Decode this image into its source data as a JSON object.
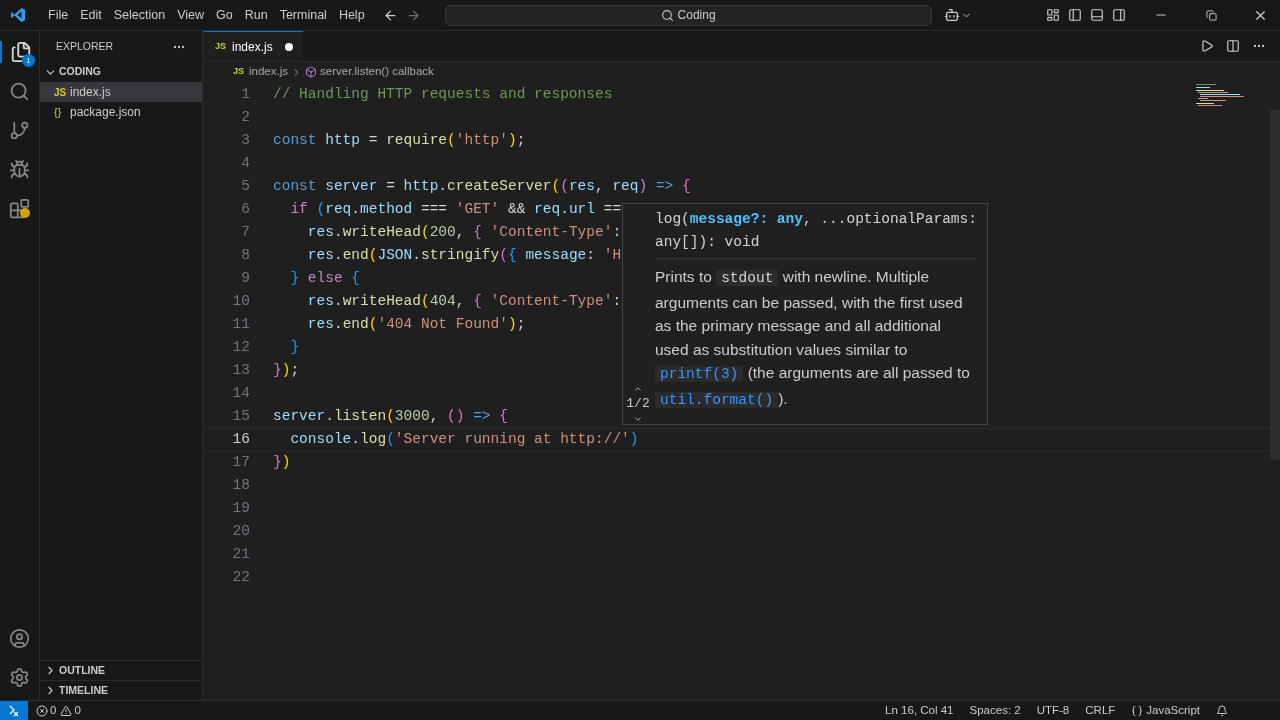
{
  "menu": [
    "File",
    "Edit",
    "Selection",
    "View",
    "Go",
    "Run",
    "Terminal",
    "Help"
  ],
  "command_center": {
    "value": "Coding"
  },
  "activity_bar": {
    "explorer_badge": "1"
  },
  "sidebar": {
    "title": "EXPLORER",
    "folder": "CODING",
    "expanded": true,
    "files": [
      {
        "name": "index.js",
        "icon_text": "JS",
        "kind": "js",
        "selected": true
      },
      {
        "name": "package.json",
        "icon_text": "{}",
        "kind": "json",
        "selected": false
      }
    ],
    "sections": [
      {
        "label": "OUTLINE",
        "expanded": false
      },
      {
        "label": "TIMELINE",
        "expanded": false
      }
    ]
  },
  "tabs": [
    {
      "label": "index.js",
      "icon_text": "JS",
      "modified": true,
      "selected": true
    }
  ],
  "breadcrumb": [
    {
      "label": "index.js",
      "icon_text": "JS",
      "kind": "file"
    },
    {
      "label": "server.listen() callback",
      "kind": "symbol"
    }
  ],
  "lines": [
    {
      "number": "1",
      "current": false,
      "tokens": [
        {
          "text": "// Handling HTTP requests and responses",
          "kind": "comment"
        }
      ]
    },
    {
      "number": "2",
      "current": false
    },
    {
      "number": "3",
      "current": false,
      "tokens": [
        {
          "text": "const",
          "kind": "kw"
        },
        {
          "text": " http",
          "kind": "var"
        },
        {
          "text": " = ",
          "kind": "plain"
        },
        {
          "text": "require",
          "kind": "fn"
        },
        {
          "text": "(",
          "kind": "b1"
        },
        {
          "text": "'http'",
          "kind": "str"
        },
        {
          "text": ")",
          "kind": "b1"
        },
        {
          "text": ";",
          "kind": "plain"
        }
      ]
    },
    {
      "number": "4",
      "current": false
    },
    {
      "number": "5",
      "current": false,
      "tokens": [
        {
          "text": "const",
          "kind": "kw"
        },
        {
          "text": " server",
          "kind": "var"
        },
        {
          "text": " = ",
          "kind": "plain"
        },
        {
          "text": "http",
          "kind": "var"
        },
        {
          "text": ".",
          "kind": "plain"
        },
        {
          "text": "createServer",
          "kind": "fn"
        },
        {
          "text": "(",
          "kind": "b1"
        },
        {
          "text": "(",
          "kind": "b2"
        },
        {
          "text": "res",
          "kind": "var"
        },
        {
          "text": ", ",
          "kind": "plain"
        },
        {
          "text": "req",
          "kind": "var"
        },
        {
          "text": ")",
          "kind": "b2"
        },
        {
          "text": " => ",
          "kind": "kw"
        },
        {
          "text": "{",
          "kind": "b2"
        }
      ]
    },
    {
      "number": "6",
      "current": false,
      "tokens": [
        {
          "text": "  if",
          "kind": "ctrl"
        },
        {
          "text": " (",
          "kind": "b3"
        },
        {
          "text": "req",
          "kind": "var"
        },
        {
          "text": ".",
          "kind": "plain"
        },
        {
          "text": "method",
          "kind": "var"
        },
        {
          "text": " === ",
          "kind": "plain"
        },
        {
          "text": "'GET'",
          "kind": "str"
        },
        {
          "text": " && ",
          "kind": "plain"
        },
        {
          "text": "req",
          "kind": "var"
        },
        {
          "text": ".",
          "kind": "plain"
        },
        {
          "text": "url",
          "kind": "var"
        },
        {
          "text": " ==",
          "kind": "plain"
        }
      ]
    },
    {
      "number": "7",
      "current": false,
      "tokens": [
        {
          "text": "    res",
          "kind": "var"
        },
        {
          "text": ".",
          "kind": "plain"
        },
        {
          "text": "writeHead",
          "kind": "fn"
        },
        {
          "text": "(",
          "kind": "b1"
        },
        {
          "text": "200",
          "kind": "num"
        },
        {
          "text": ", ",
          "kind": "plain"
        },
        {
          "text": "{",
          "kind": "b2"
        },
        {
          "text": " 'Content-Type'",
          "kind": "str"
        },
        {
          "text": ":",
          "kind": "plain"
        }
      ]
    },
    {
      "number": "8",
      "current": false,
      "tokens": [
        {
          "text": "    res",
          "kind": "var"
        },
        {
          "text": ".",
          "kind": "plain"
        },
        {
          "text": "end",
          "kind": "fn"
        },
        {
          "text": "(",
          "kind": "b1"
        },
        {
          "text": "JSON",
          "kind": "var"
        },
        {
          "text": ".",
          "kind": "plain"
        },
        {
          "text": "stringify",
          "kind": "fn"
        },
        {
          "text": "(",
          "kind": "b2"
        },
        {
          "text": "{",
          "kind": "b3"
        },
        {
          "text": " message",
          "kind": "var"
        },
        {
          "text": ": ",
          "kind": "plain"
        },
        {
          "text": "'H",
          "kind": "str"
        }
      ]
    },
    {
      "number": "9",
      "current": false,
      "tokens": [
        {
          "text": "  }",
          "kind": "b3"
        },
        {
          "text": " else",
          "kind": "ctrl"
        },
        {
          "text": " {",
          "kind": "b3"
        }
      ]
    },
    {
      "number": "10",
      "current": false,
      "tokens": [
        {
          "text": "    res",
          "kind": "var"
        },
        {
          "text": ".",
          "kind": "plain"
        },
        {
          "text": "writeHead",
          "kind": "fn"
        },
        {
          "text": "(",
          "kind": "b1"
        },
        {
          "text": "404",
          "kind": "num"
        },
        {
          "text": ", ",
          "kind": "plain"
        },
        {
          "text": "{",
          "kind": "b2"
        },
        {
          "text": " 'Content-Type'",
          "kind": "str"
        },
        {
          "text": ":",
          "kind": "plain"
        }
      ]
    },
    {
      "number": "11",
      "current": false,
      "tokens": [
        {
          "text": "    res",
          "kind": "var"
        },
        {
          "text": ".",
          "kind": "plain"
        },
        {
          "text": "end",
          "kind": "fn"
        },
        {
          "text": "(",
          "kind": "b1"
        },
        {
          "text": "'404 Not Found'",
          "kind": "str"
        },
        {
          "text": ")",
          "kind": "b1"
        },
        {
          "text": ";",
          "kind": "plain"
        }
      ]
    },
    {
      "number": "12",
      "current": false,
      "tokens": [
        {
          "text": "  }",
          "kind": "b3"
        }
      ]
    },
    {
      "number": "13",
      "current": false,
      "tokens": [
        {
          "text": "}",
          "kind": "b2"
        },
        {
          "text": ")",
          "kind": "b1"
        },
        {
          "text": ";",
          "kind": "plain"
        }
      ]
    },
    {
      "number": "14",
      "current": false
    },
    {
      "number": "15",
      "current": false,
      "tokens": [
        {
          "text": "server",
          "kind": "var"
        },
        {
          "text": ".",
          "kind": "plain"
        },
        {
          "text": "listen",
          "kind": "fn"
        },
        {
          "text": "(",
          "kind": "b1"
        },
        {
          "text": "3000",
          "kind": "num"
        },
        {
          "text": ", ",
          "kind": "plain"
        },
        {
          "text": "(",
          "kind": "b2"
        },
        {
          "text": ")",
          "kind": "b2"
        },
        {
          "text": " => ",
          "kind": "kw"
        },
        {
          "text": "{",
          "kind": "b2"
        }
      ]
    },
    {
      "number": "16",
      "current": true,
      "tokens": [
        {
          "text": "  console",
          "kind": "var"
        },
        {
          "text": ".",
          "kind": "plain"
        },
        {
          "text": "log",
          "kind": "fn"
        },
        {
          "text": "(",
          "kind": "b3"
        },
        {
          "text": "'Server running at http://'",
          "kind": "str"
        },
        {
          "text": ")",
          "kind": "b3"
        }
      ]
    },
    {
      "number": "17",
      "current": false,
      "tokens": [
        {
          "text": "}",
          "kind": "b2"
        },
        {
          "text": ")",
          "kind": "b1"
        }
      ]
    },
    {
      "number": "18",
      "current": false
    },
    {
      "number": "19",
      "current": false
    },
    {
      "number": "20",
      "current": false
    },
    {
      "number": "21",
      "current": false
    },
    {
      "number": "22",
      "current": false
    }
  ],
  "hover": {
    "signature": [
      {
        "text": "log(",
        "kind": "plain"
      },
      {
        "text": "message?: any",
        "kind": "param"
      },
      {
        "text": ", ...optionalParams: any[]): void",
        "kind": "plain"
      }
    ],
    "description": [
      {
        "text": "Prints to ",
        "kind": "text"
      },
      {
        "text": "stdout",
        "kind": "mono"
      },
      {
        "text": " with newline. Multiple arguments can be passed, with the first used as the primary message and all additional used as substitution values similar to ",
        "kind": "text"
      },
      {
        "text": "printf(3)",
        "kind": "code"
      },
      {
        "text": " (the arguments are all passed to ",
        "kind": "text"
      },
      {
        "text": "util.format()",
        "kind": "code"
      },
      {
        "text": ").",
        "kind": "text"
      }
    ],
    "overload": "1/2"
  },
  "status_bar": {
    "errors": "0",
    "warnings": "0",
    "items": [
      "Ln 16, Col 41",
      "Spaces: 2",
      "UTF-8",
      "CRLF"
    ],
    "language": "JavaScript"
  }
}
